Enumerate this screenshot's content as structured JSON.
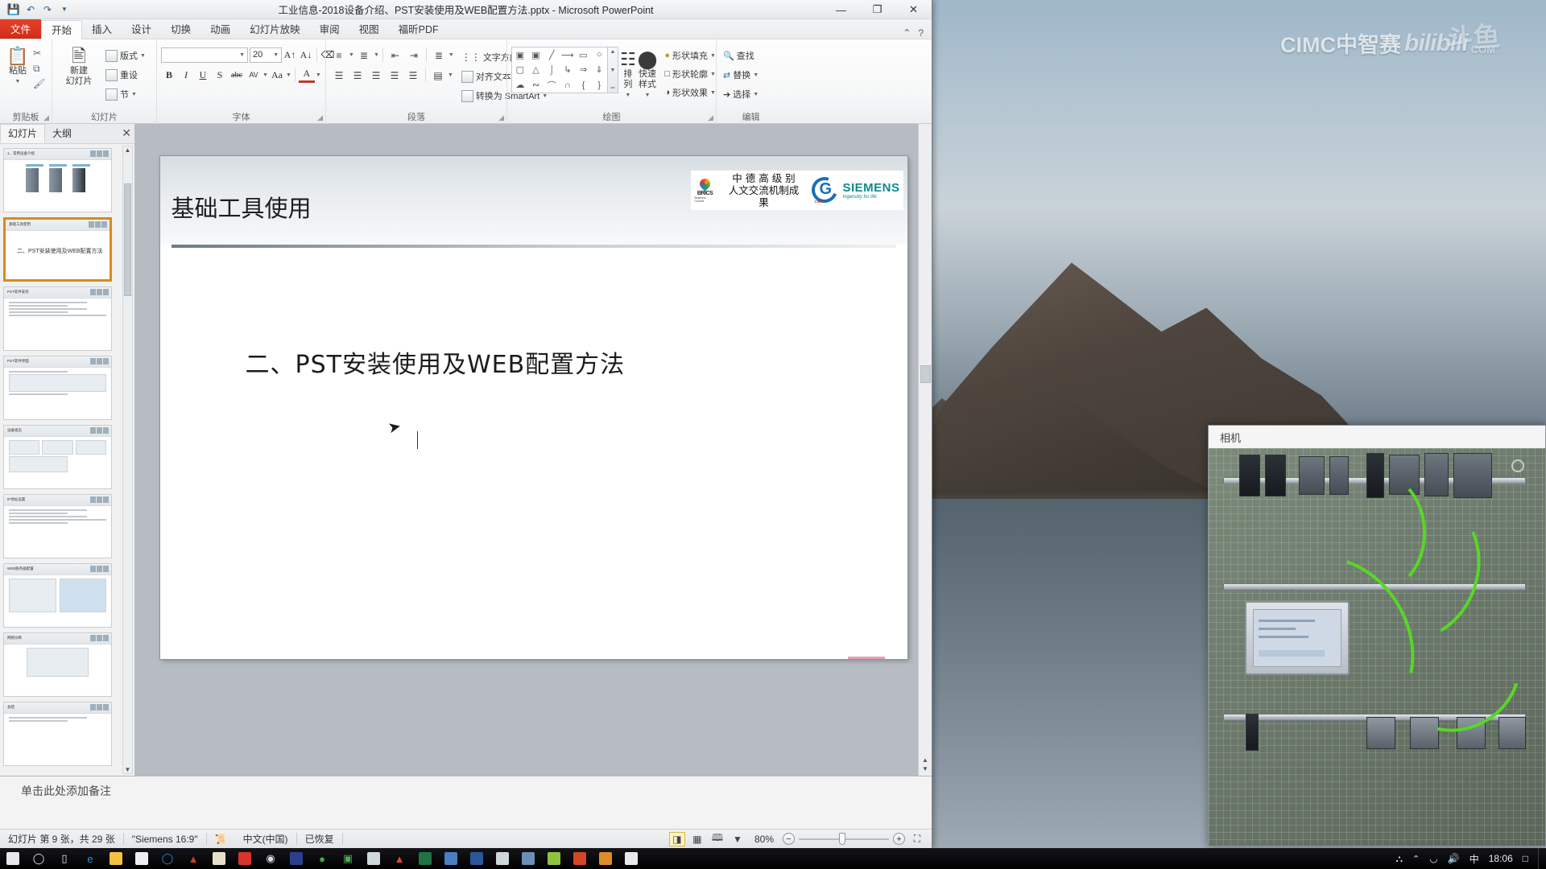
{
  "watermark": {
    "brand": "CIMC中智赛",
    "bili": "bilibili",
    "com": "COM",
    "douyu": "斗鱼"
  },
  "powerpoint": {
    "titlebar": {
      "document_title": "工业信息-2018设备介绍、PST安装使用及WEB配置方法.pptx  -  Microsoft PowerPoint",
      "quick_access": [
        {
          "name": "save-icon",
          "glyph": "⬓"
        },
        {
          "name": "undo-icon",
          "glyph": "↶"
        },
        {
          "name": "redo-icon",
          "glyph": "↷"
        },
        {
          "name": "customize-qat-icon",
          "glyph": "▾"
        }
      ],
      "minimize": "—",
      "maximize": "❐",
      "close": "✕"
    },
    "tabs": {
      "file": "文件",
      "items": [
        "开始",
        "插入",
        "设计",
        "切换",
        "动画",
        "幻灯片放映",
        "审阅",
        "视图",
        "福昕PDF"
      ],
      "active": "开始",
      "minimize_ribbon": "⌃",
      "help": "?"
    },
    "ribbon": {
      "groups": [
        {
          "label": "剪贴板",
          "paste_label": "粘贴",
          "commands": [
            "剪切",
            "复制",
            "格式刷"
          ],
          "icons": [
            "paste-icon",
            "cut-icon",
            "copy-icon",
            "format-painter-icon"
          ]
        },
        {
          "label": "幻灯片",
          "new_slide": "新建\n幻灯片",
          "new_slide_line1": "新建",
          "new_slide_line2": "幻灯片",
          "commands": [
            "版式",
            "重设",
            "节"
          ]
        },
        {
          "label": "字体",
          "font_name": "",
          "font_size": "20",
          "buttons": [
            "B",
            "I",
            "U",
            "S",
            "abc",
            "AV",
            "A",
            "A↑",
            "A↓",
            "清除格式",
            "Aa",
            "字体颜色"
          ]
        },
        {
          "label": "段落",
          "commands": [
            "项目符号",
            "编号",
            "降低列表级别",
            "提高列表级别",
            "行距",
            "文字方向",
            "对齐文本",
            "转换为 SmartArt"
          ],
          "text_direction": "文字方向",
          "align_text": "对齐文本",
          "to_smartart": "转换为 SmartArt"
        },
        {
          "label": "绘图",
          "arrange": "排列",
          "quickstyle": "快速样式",
          "shape_fill": "形状填充",
          "shape_outline": "形状轮廓",
          "shape_effects": "形状效果"
        },
        {
          "label": "编辑",
          "find": "查找",
          "replace": "替换",
          "select": "选择"
        }
      ]
    },
    "thumbnail_pane": {
      "tabs": [
        "幻灯片",
        "大纲"
      ],
      "active_tab": "幻灯片",
      "close": "✕",
      "selected_index": 1,
      "slides": [
        {
          "title": "1、常用设备介绍",
          "kind": "hardware"
        },
        {
          "title": "二、PST安装使用及WEB配置方法",
          "kind": "section"
        },
        {
          "title": "PST软件安装",
          "kind": "text"
        },
        {
          "title": "PST软件界面",
          "kind": "text"
        },
        {
          "title": "设备组态",
          "kind": "diagram"
        },
        {
          "title": "IP地址设置",
          "kind": "text"
        },
        {
          "title": "WEB服务器配置",
          "kind": "screens"
        },
        {
          "title": "网络诊断",
          "kind": "chart"
        },
        {
          "title": "总结",
          "kind": "text"
        }
      ]
    },
    "slide": {
      "header_title": "基础工具使用",
      "logos": {
        "brics": "BRICS",
        "brics_sub": "Business Council",
        "chinese": "中 德 高 级 别\n人文交流机制成\n果",
        "chinese_l1": "中 德 高 级 别",
        "chinese_l2": "人文交流机制成",
        "chinese_l3": "果",
        "cimc": "CIMC",
        "siemens": "SIEMENS",
        "siemens_tag": "Ingenuity for life"
      },
      "main_title": "二、PST安装使用及WEB配置方法",
      "cursor_icon": "➤"
    },
    "notes": {
      "placeholder": "单击此处添加备注"
    },
    "statusbar": {
      "slide_count": "幻灯片 第 9 张，共 29 张",
      "theme": "\"Siemens 16:9\"",
      "language": "中文(中国)",
      "recovery": "已恢复",
      "zoom": "80%",
      "view_buttons": [
        "普通视图",
        "幻灯片浏览",
        "阅读视图",
        "幻灯片放映"
      ],
      "zoom_out": "−",
      "zoom_in": "+",
      "fit_window": "⛶"
    }
  },
  "camera_window": {
    "title": "相机"
  },
  "taskbar": {
    "icons": [
      "start-icon",
      "cortana-icon",
      "task-view-icon",
      "edge-icon",
      "explorer-icon",
      "store-icon",
      "opera-icon",
      "player-icon",
      "notepad-icon",
      "qq-icon",
      "chrome-icon",
      "step7-icon",
      "wechat-icon",
      "winrar-icon",
      "antivirus-icon",
      "adobe-icon",
      "excel-icon",
      "foxit-icon",
      "word-icon",
      "calculator-icon",
      "tia-icon",
      "portal-icon",
      "powerpoint-icon",
      "help-icon",
      "camera-icon"
    ],
    "tray": {
      "network_share": "⛬",
      "chevron": "⌃",
      "wifi": "◡",
      "volume": "ὐa",
      "input": "中",
      "clock": "18:06",
      "action_center": "□"
    }
  }
}
